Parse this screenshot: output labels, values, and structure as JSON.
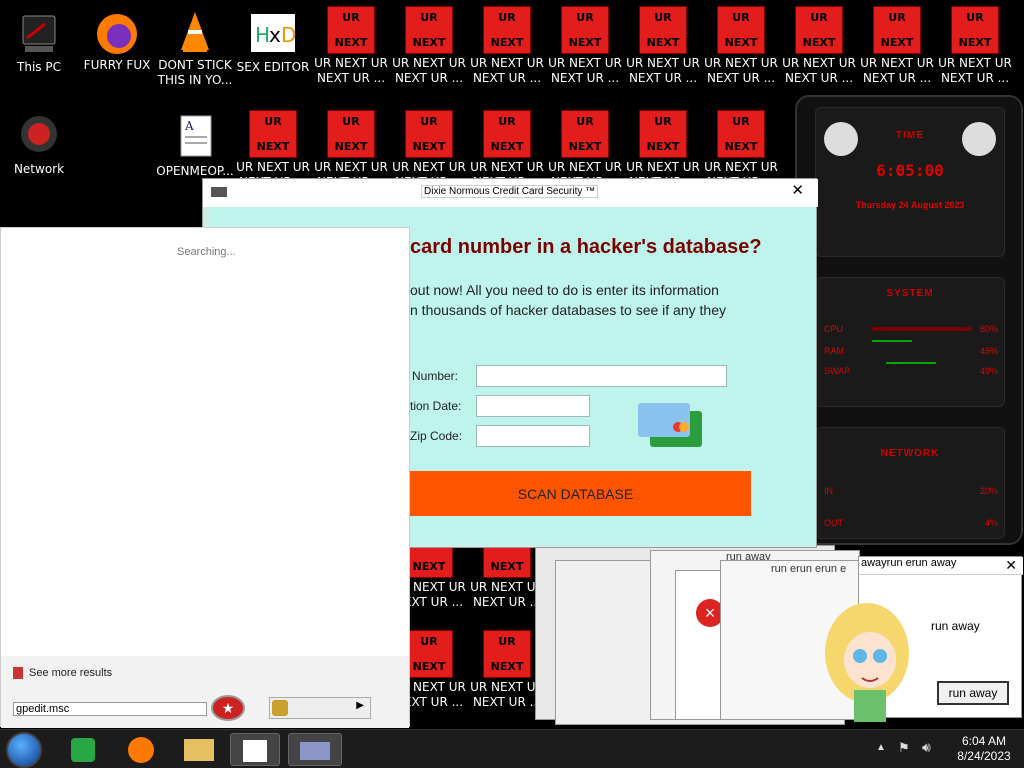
{
  "desktop_icons": [
    {
      "label": "This PC",
      "icon": "computer-icon"
    },
    {
      "label": "FURRY FUX",
      "icon": "firefox-icon"
    },
    {
      "label": "DONT STICK THIS IN YO...",
      "icon": "vlc-icon"
    },
    {
      "label": "SEX EDITOR",
      "icon": "hxd-icon"
    },
    {
      "label": "Network",
      "icon": "network-icon"
    },
    {
      "label": "OPENMEOP...",
      "icon": "document-icon"
    }
  ],
  "ur_tile": {
    "top": "UR",
    "bottom": "NEXT",
    "label": "UR NEXT UR NEXT UR ..."
  },
  "gadget": {
    "time_title": "TIME",
    "time": "6:05:00",
    "date": "Thursday 24 August 2023",
    "system_title": "SYSTEM",
    "cpu_label": "CPU",
    "cpu_value": "80%",
    "ram_label": "RAM",
    "ram_value": "45%",
    "swap_label": "SWAP",
    "swap_value": "49%",
    "network_title": "NETWORK",
    "in_label": "IN",
    "in_value": "20%",
    "out_label": "OUT",
    "out_value": "4%"
  },
  "cc_window": {
    "title": "Dixie Normous Credit Card Security ™",
    "heading": "card number in a hacker's database?",
    "desc_line1": "out now! All you need to do is enter its information",
    "desc_line2": "n thousands of hacker databases to see if any they",
    "label_number": "Number:",
    "label_expiry": "tion Date:",
    "label_zip": "Zip Code:",
    "scan_button": "SCAN DATABASE"
  },
  "start_menu": {
    "searching": "Searching...",
    "see_more": "See more results",
    "search_value": "gpedit.msc"
  },
  "run_away": {
    "title1": "run away",
    "title2": "run erun erun e",
    "title3": "awayrun erun away",
    "message": "run away",
    "button": "run away"
  },
  "tray": {
    "time": "6:04 AM",
    "date": "8/24/2023"
  }
}
